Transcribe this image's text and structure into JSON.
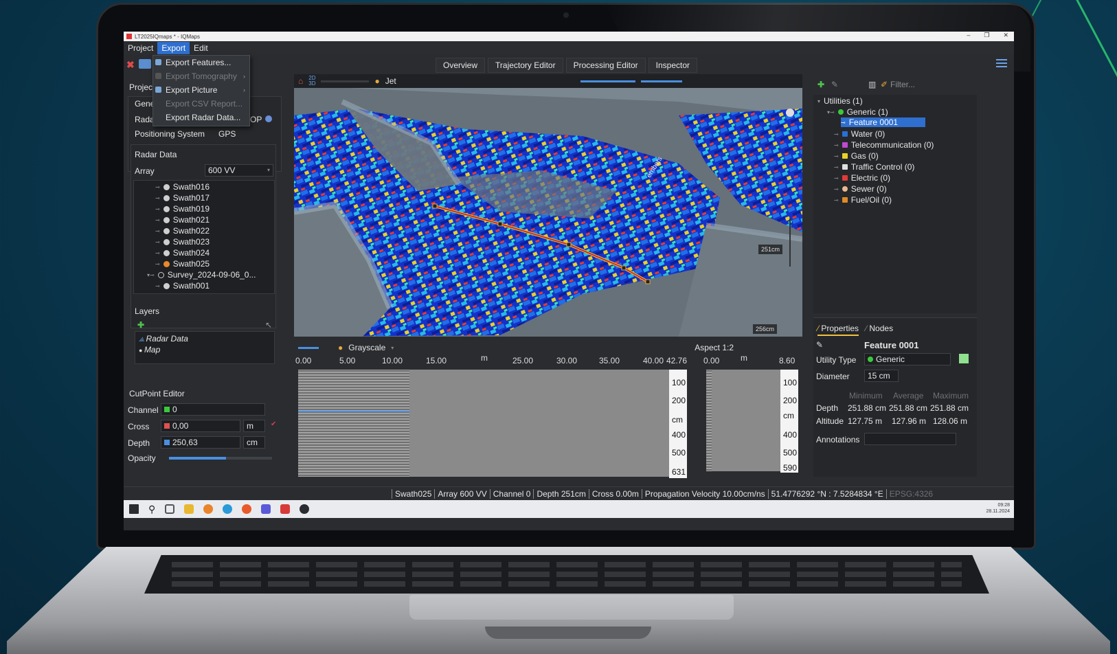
{
  "window": {
    "title": "LT2025IQmaps * - IQMaps",
    "controls": [
      "–",
      "❐",
      "✕"
    ]
  },
  "menu": {
    "items": [
      "Project",
      "Export",
      "Edit"
    ]
  },
  "export_menu": {
    "items": [
      {
        "label": "Export Features...",
        "enabled": true
      },
      {
        "label": "Export Tomography",
        "enabled": false
      },
      {
        "label": "Export Picture",
        "enabled": true
      },
      {
        "label": "Export CSV Report...",
        "enabled": false
      },
      {
        "label": "Export Radar Data...",
        "enabled": true
      }
    ]
  },
  "main_tabs": [
    "Overview",
    "Trajectory Editor",
    "Processing Editor",
    "Inspector"
  ],
  "left": {
    "project_label": "Projec",
    "general_label": "Gene",
    "radar_label": "Rada",
    "radar_suffix": "OP",
    "positioning_label": "Positioning System",
    "positioning_value": "GPS",
    "radar_data": {
      "title": "Radar Data",
      "array_label": "Array",
      "array_value": "600 VV"
    },
    "swaths": [
      "Swath016",
      "Swath017",
      "Swath019",
      "Swath021",
      "Swath022",
      "Swath023",
      "Swath024",
      "Swath025"
    ],
    "survey": "Survey_2024-09-06_0...",
    "survey_child": "Swath001",
    "layers": {
      "title": "Layers",
      "items": [
        "Radar Data",
        "Map"
      ]
    },
    "cutpoint": {
      "title": "CutPoint Editor",
      "channel_label": "Channel",
      "channel_value": "0",
      "cross_label": "Cross",
      "cross_value": "0,00",
      "cross_unit": "m",
      "depth_label": "Depth",
      "depth_value": "250,63",
      "depth_unit": "cm",
      "opacity_label": "Opacity",
      "opacity_level": 0.55
    }
  },
  "viewport": {
    "mode_2d": "2D",
    "mode_3d": "3D",
    "colormap": "Jet",
    "scale_label_1": "251cm",
    "scale_label_2": "256cm",
    "street_label": "ernbers"
  },
  "radargram": {
    "colormap": "Grayscale",
    "aspect_label": "Aspect 1:2",
    "x_unit": "m",
    "x_ticks": [
      "0.00",
      "5.00",
      "10.00",
      "15.00",
      "25.00",
      "30.00",
      "35.00",
      "40.00",
      "42.76"
    ],
    "depth_ticks": [
      "100",
      "200",
      "cm",
      "400",
      "500",
      "631"
    ],
    "cross_x_ticks": [
      "0.00",
      "m",
      "8.60"
    ],
    "cross_depth_ticks": [
      "100",
      "200",
      "cm",
      "400",
      "500",
      "590"
    ]
  },
  "right": {
    "filter_placeholder": "Filter...",
    "utilities": [
      {
        "label": "Utilities (1)",
        "color": ""
      },
      {
        "label": "Generic (1)",
        "color": "#3cc83c"
      },
      {
        "label": "Feature 0001",
        "color": "#6aa2e8"
      },
      {
        "label": "Water (0)",
        "color": "#2a6fd6"
      },
      {
        "label": "Telecommunication (0)",
        "color": "#c04ad0"
      },
      {
        "label": "Gas (0)",
        "color": "#e6d22a"
      },
      {
        "label": "Traffic Control (0)",
        "color": "#e0e0e0"
      },
      {
        "label": "Electric (0)",
        "color": "#e03a3a"
      },
      {
        "label": "Sewer (0)",
        "color": "#e8b890"
      },
      {
        "label": "Fuel/Oil (0)",
        "color": "#e08a2a"
      }
    ],
    "props": {
      "tab_properties": "Properties",
      "tab_nodes": "Nodes",
      "feature_name": "Feature 0001",
      "utility_type_label": "Utility Type",
      "utility_type_value": "Generic",
      "diameter_label": "Diameter",
      "diameter_value": "15 cm",
      "col_min": "Minimum",
      "col_avg": "Average",
      "col_max": "Maximum",
      "depth_label": "Depth",
      "depth_min": "251.88 cm",
      "depth_avg": "251.88 cm",
      "depth_max": "251.88 cm",
      "altitude_label": "Altitude",
      "alt_min": "127.75 m",
      "alt_avg": "127.96 m",
      "alt_max": "128.06 m",
      "annotations_label": "Annotations"
    }
  },
  "status": {
    "swath": "Swath025",
    "array": "Array 600 VV",
    "channel": "Channel    0",
    "depth": "Depth    251cm",
    "cross": "Cross       0.00m",
    "velocity": "Propagation Velocity 10.00cm/ns",
    "coords": "51.4776292 °N : 7.5284834 °E",
    "epsg": "EPSG:4326"
  },
  "taskbar": {
    "time": "09:28",
    "date": "28.11.2024"
  },
  "colors": {
    "accent": "#2f6fcf",
    "panel": "#2a2c30",
    "brand_green": "#2ecc71"
  }
}
